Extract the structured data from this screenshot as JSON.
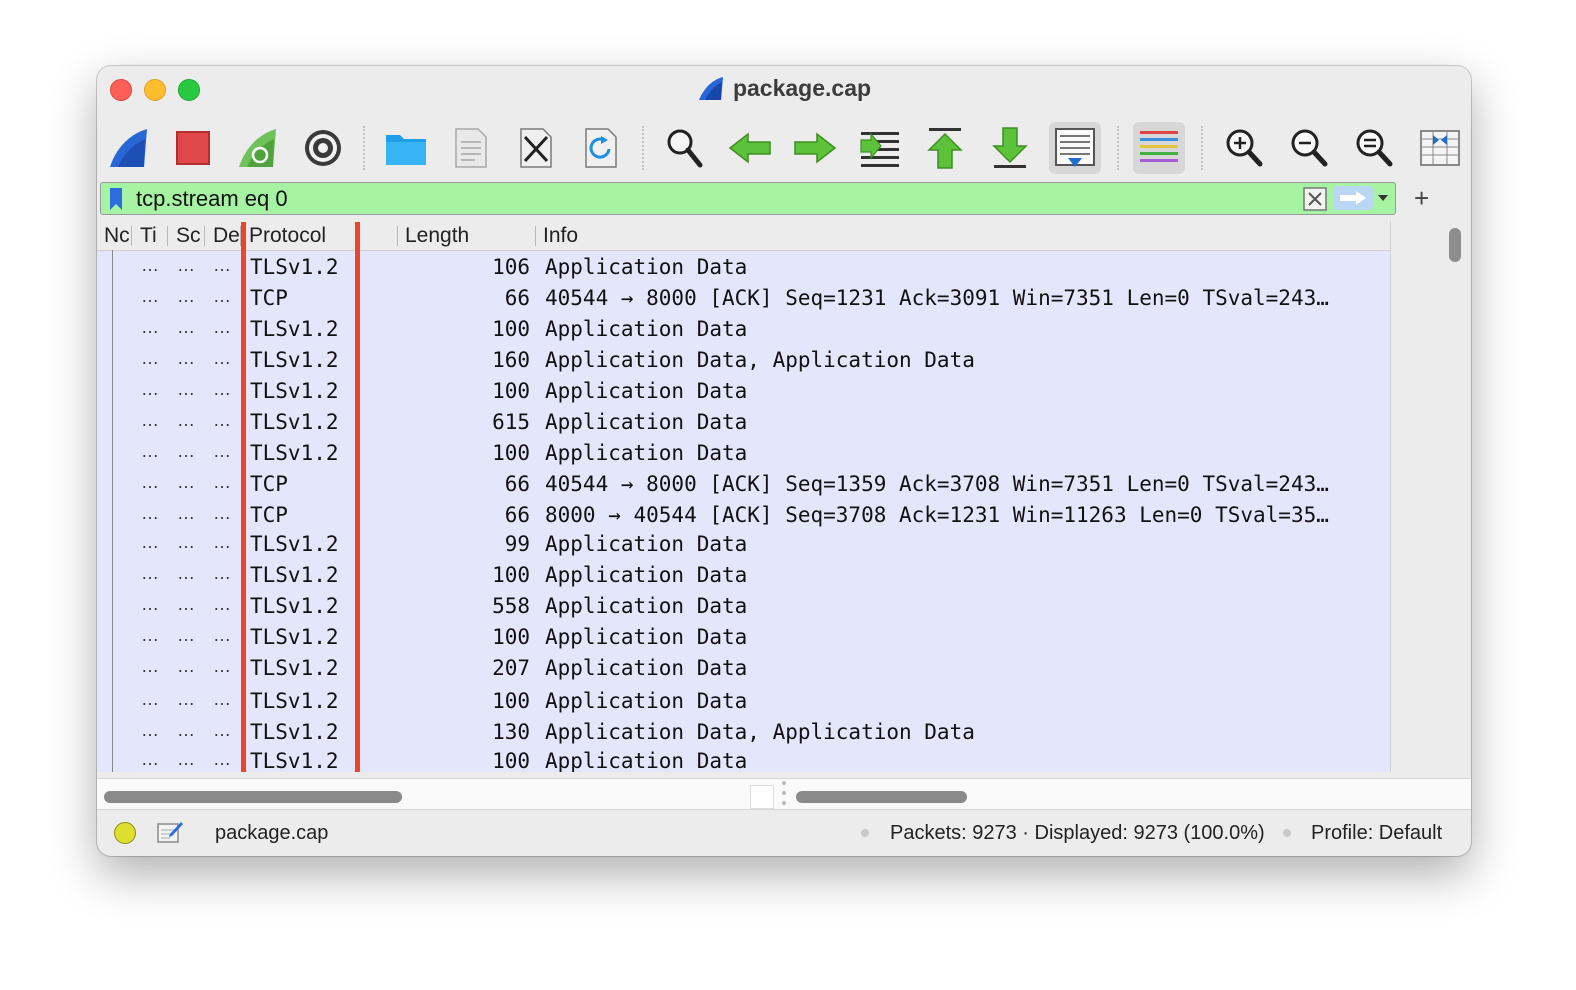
{
  "window": {
    "title": "package.cap"
  },
  "filter": {
    "value": "tcp.stream eq 0",
    "add_label": "+"
  },
  "columns": [
    "No",
    "Time",
    "Source",
    "Destination",
    "Protocol",
    "Length",
    "Info"
  ],
  "column_headers_visible": [
    "Nc",
    "Ti",
    "Sc",
    "De",
    "Protocol",
    "Length",
    "Info"
  ],
  "ellipsis": "…",
  "packets": [
    {
      "protocol": "TLSv1.2",
      "length": "106",
      "info": "Application Data"
    },
    {
      "protocol": "TCP",
      "length": "66",
      "info": "40544 → 8000 [ACK] Seq=1231 Ack=3091 Win=7351 Len=0 TSval=243…"
    },
    {
      "protocol": "TLSv1.2",
      "length": "100",
      "info": "Application Data"
    },
    {
      "protocol": "TLSv1.2",
      "length": "160",
      "info": "Application Data, Application Data"
    },
    {
      "protocol": "TLSv1.2",
      "length": "100",
      "info": "Application Data"
    },
    {
      "protocol": "TLSv1.2",
      "length": "615",
      "info": "Application Data"
    },
    {
      "protocol": "TLSv1.2",
      "length": "100",
      "info": "Application Data"
    },
    {
      "protocol": "TCP",
      "length": "66",
      "info": "40544 → 8000 [ACK] Seq=1359 Ack=3708 Win=7351 Len=0 TSval=243…"
    },
    {
      "protocol": "TCP",
      "length": "66",
      "info": "8000 → 40544 [ACK] Seq=3708 Ack=1231 Win=11263 Len=0 TSval=35…"
    },
    {
      "protocol": "TLSv1.2",
      "length": "99",
      "info": "Application Data"
    },
    {
      "protocol": "TLSv1.2",
      "length": "100",
      "info": "Application Data"
    },
    {
      "protocol": "TLSv1.2",
      "length": "558",
      "info": "Application Data"
    },
    {
      "protocol": "TLSv1.2",
      "length": "100",
      "info": "Application Data"
    },
    {
      "protocol": "TLSv1.2",
      "length": "207",
      "info": "Application Data"
    },
    {
      "protocol": "TLSv1.2",
      "length": "100",
      "info": "Application Data"
    },
    {
      "protocol": "TLSv1.2",
      "length": "130",
      "info": "Application Data, Application Data"
    },
    {
      "protocol": "TLSv1.2",
      "length": "100",
      "info": "Application Data"
    }
  ],
  "status": {
    "file": "package.cap",
    "packets": "Packets: 9273 · Displayed: 9273 (100.0%)",
    "profile": "Profile: Default"
  },
  "toolbar_icons": [
    "start-capture-icon",
    "stop-capture-icon",
    "restart-capture-icon",
    "capture-options-icon",
    "open-file-icon",
    "save-file-icon",
    "close-file-icon",
    "reload-file-icon",
    "find-packet-icon",
    "go-back-icon",
    "go-forward-icon",
    "go-to-packet-icon",
    "go-first-packet-icon",
    "go-last-packet-icon",
    "autoscroll-icon",
    "colorize-icon",
    "zoom-in-icon",
    "zoom-out-icon",
    "normal-size-icon",
    "resize-columns-icon"
  ],
  "colors": {
    "filter_valid": "#a6f3a4",
    "list_bg": "#e4e6fb",
    "highlight": "#e8462d",
    "accent": "#2d6be0"
  }
}
